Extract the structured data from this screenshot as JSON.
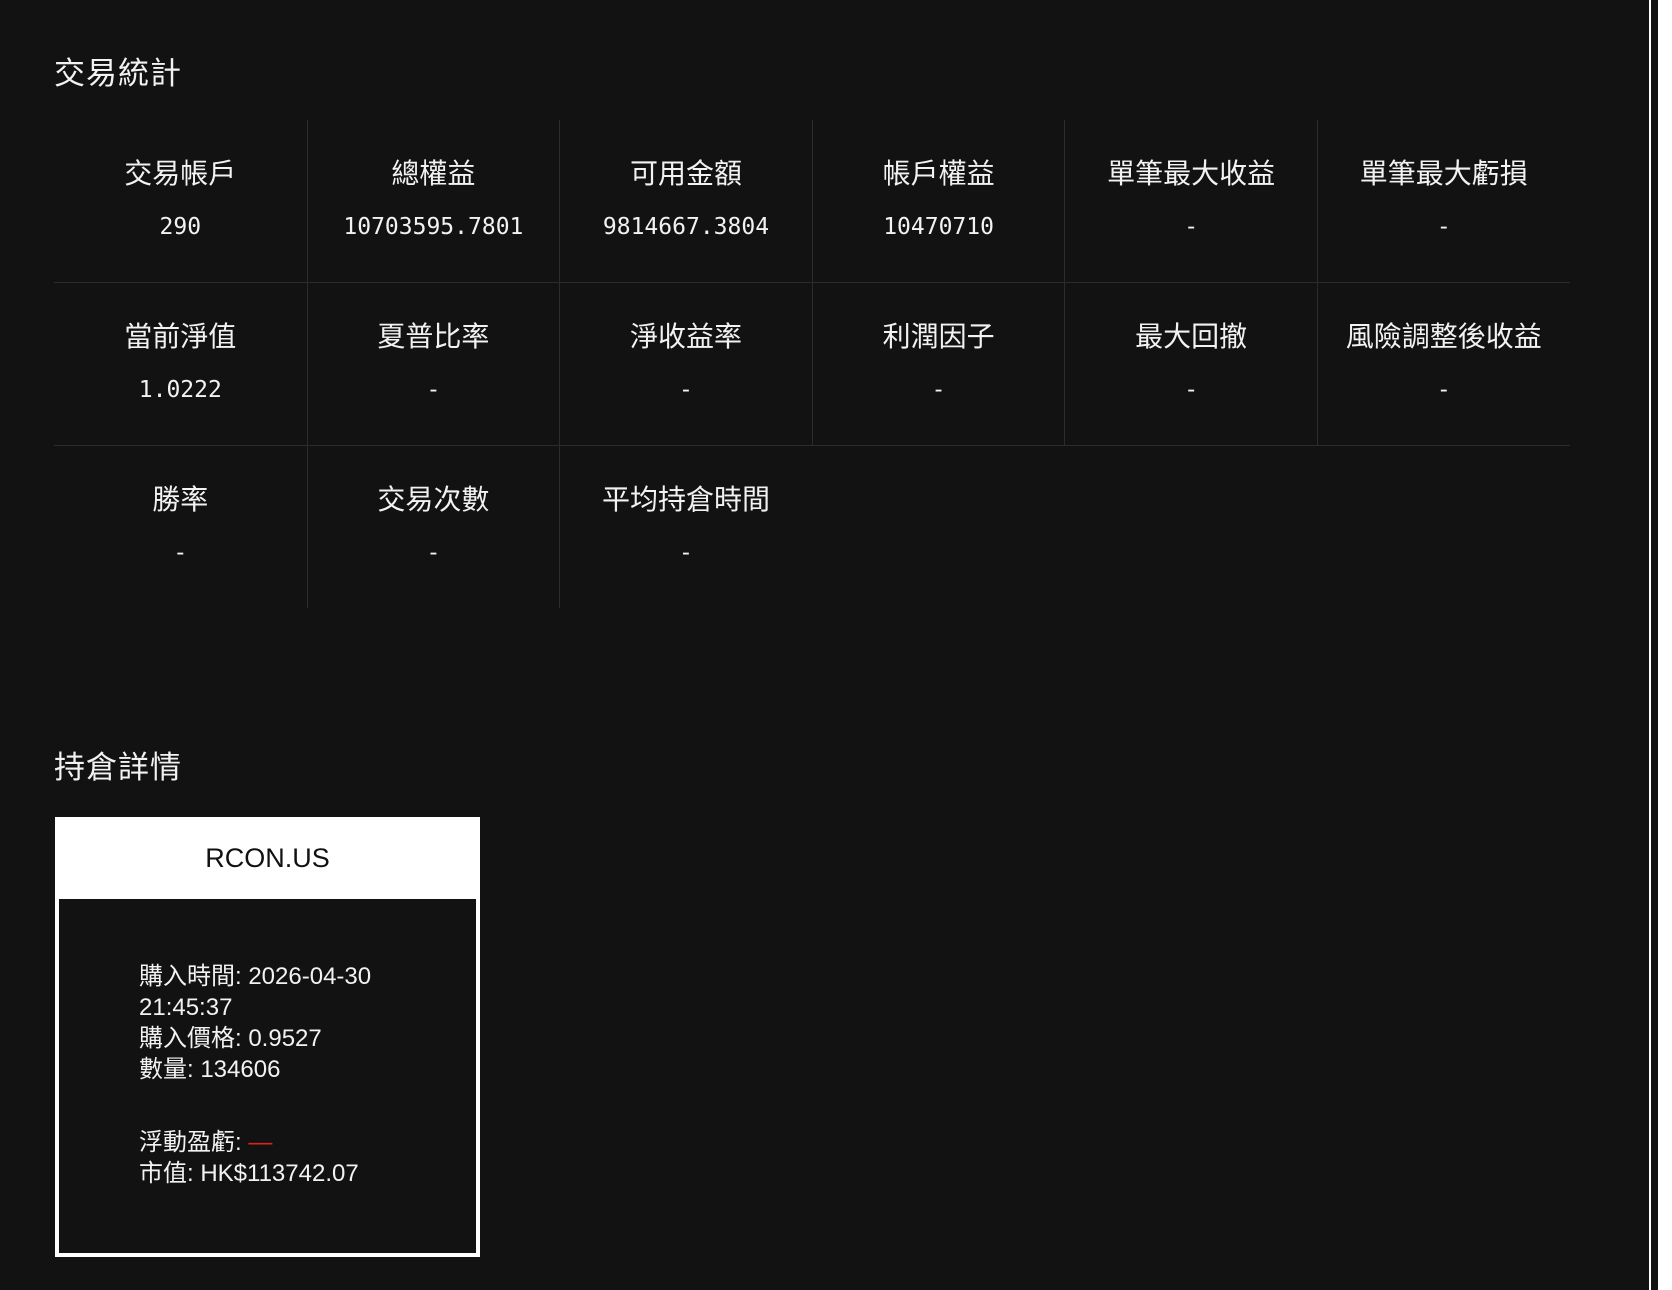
{
  "stats": {
    "title": "交易統計",
    "rows": [
      [
        {
          "label": "交易帳戶",
          "value": "290"
        },
        {
          "label": "總權益",
          "value": "10703595.7801"
        },
        {
          "label": "可用金額",
          "value": "9814667.3804"
        },
        {
          "label": "帳戶權益",
          "value": "10470710"
        },
        {
          "label": "單筆最大收益",
          "value": "-"
        },
        {
          "label": "單筆最大虧損",
          "value": "-"
        }
      ],
      [
        {
          "label": "當前淨值",
          "value": "1.0222"
        },
        {
          "label": "夏普比率",
          "value": "-"
        },
        {
          "label": "淨收益率",
          "value": "-"
        },
        {
          "label": "利潤因子",
          "value": "-"
        },
        {
          "label": "最大回撤",
          "value": "-"
        },
        {
          "label": "風險調整後收益",
          "value": "-"
        }
      ],
      [
        {
          "label": "勝率",
          "value": "-"
        },
        {
          "label": "交易次數",
          "value": "-"
        },
        {
          "label": "平均持倉時間",
          "value": "-"
        }
      ]
    ]
  },
  "positions": {
    "title": "持倉詳情",
    "cards": [
      {
        "symbol": "RCON.US",
        "buy_time": "購入時間: 2026-04-30 21:45:37",
        "buy_price": "購入價格: 0.9527",
        "quantity": "數量: 134606",
        "pnl_label": "浮動盈虧: ",
        "pnl_value": "—",
        "market_value": "市值: HK$113742.07"
      }
    ]
  },
  "colors": {
    "background": "#121212",
    "text": "#f2f2f2",
    "grid_line": "#2c2c2c",
    "pnl_negative": "#e0201c",
    "card_header": "#ffffff"
  }
}
